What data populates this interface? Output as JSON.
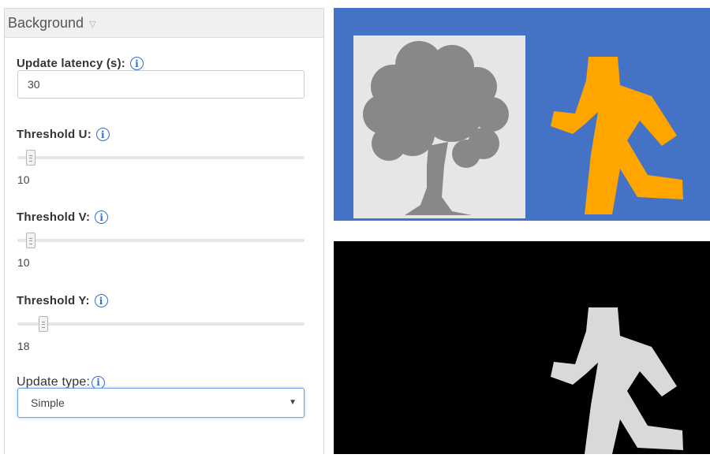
{
  "panel": {
    "title": "Background",
    "latency": {
      "label": "Update latency (s):",
      "value": "30"
    },
    "threshold_u": {
      "label": "Threshold U:",
      "value": "10",
      "level": 0.03
    },
    "threshold_v": {
      "label": "Threshold V:",
      "value": "10",
      "level": 0.03
    },
    "threshold_y": {
      "label": "Threshold Y:",
      "value": "18",
      "level": 0.075
    },
    "update_type": {
      "label": "Update type:",
      "selected": "Simple"
    }
  },
  "icons": {
    "info": "i",
    "caret": "▽",
    "select_arrow": "▼"
  },
  "colors": {
    "image_background": "#4472c4",
    "tree_gray": "#888888",
    "runner_orange": "#ffa500",
    "mask_white": "#d9d9d9"
  }
}
